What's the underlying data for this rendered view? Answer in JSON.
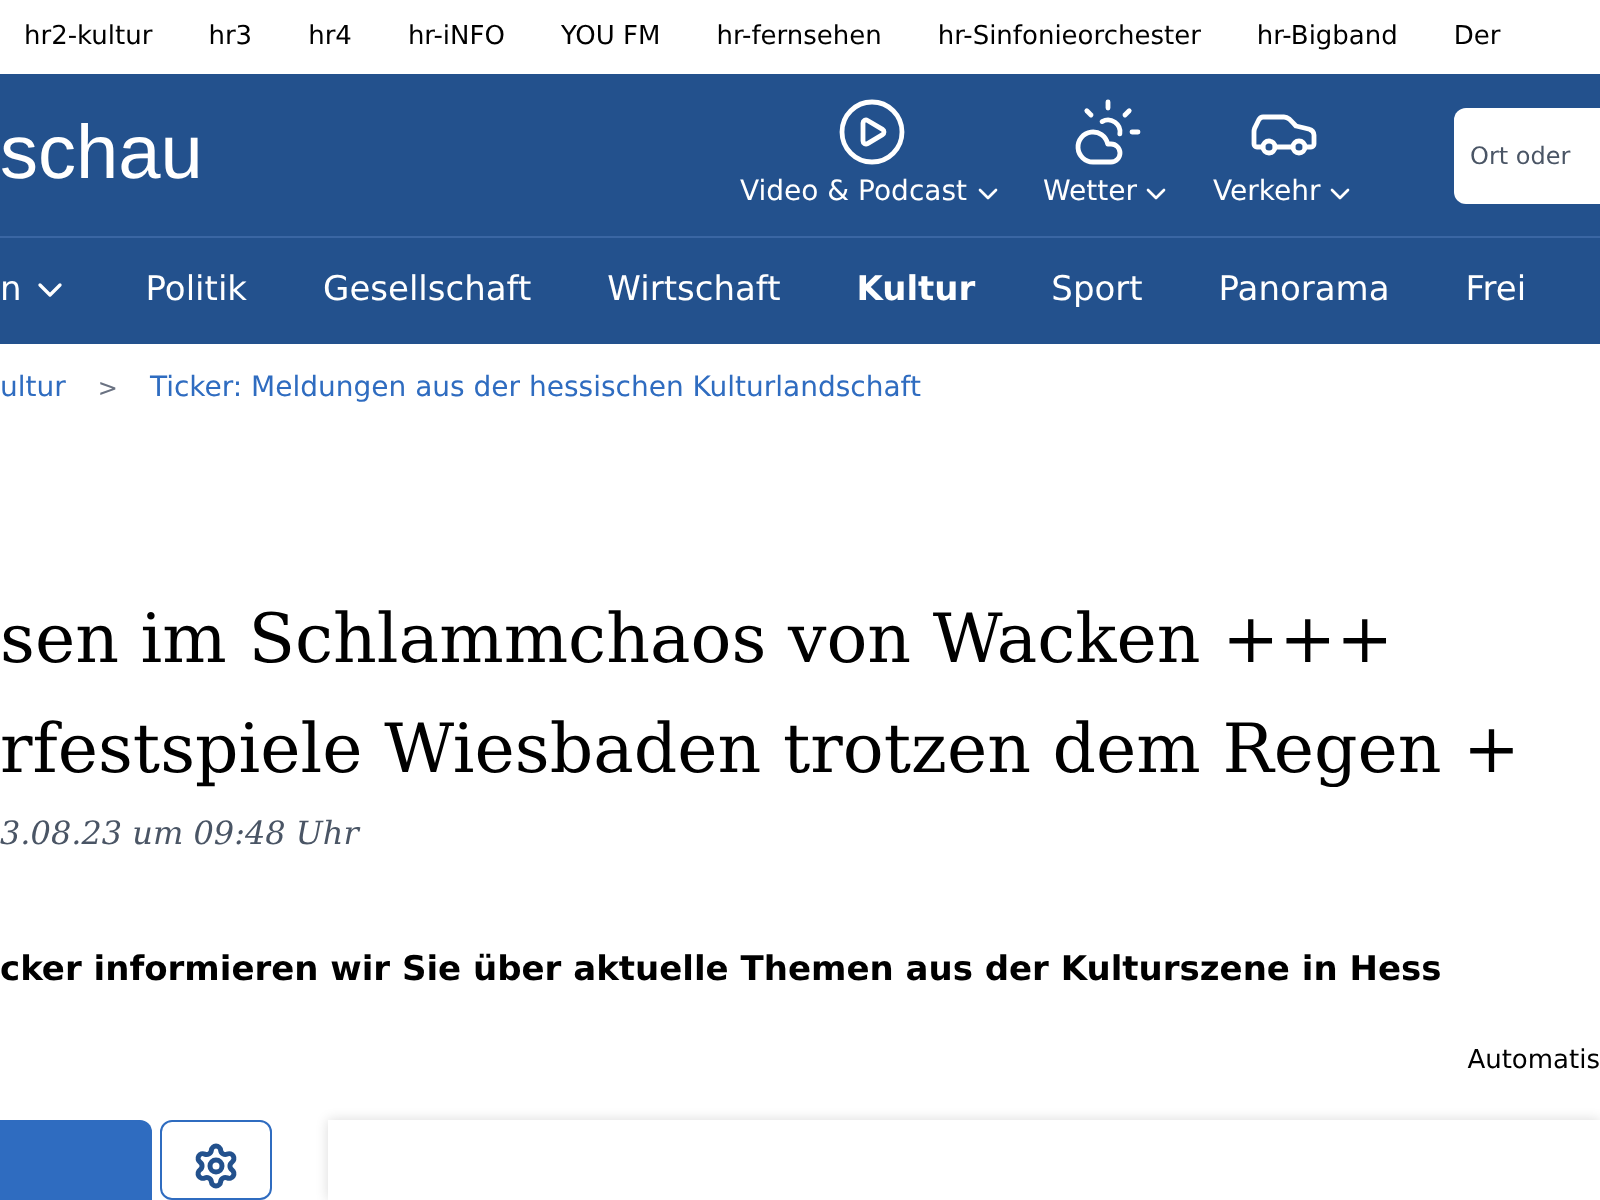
{
  "top_links": [
    "hr2-kultur",
    "hr3",
    "hr4",
    "hr-iNFO",
    "YOU FM",
    "hr-fernsehen",
    "hr-Sinfonieorchester",
    "hr-Bigband",
    "Der"
  ],
  "header": {
    "logo_text": "schau",
    "menus": [
      {
        "label": "Video & Podcast",
        "kind": "video"
      },
      {
        "label": "Wetter",
        "kind": "weather"
      },
      {
        "label": "Verkehr",
        "kind": "traffic"
      }
    ],
    "search": {
      "placeholder": "Ort oder"
    }
  },
  "nav": [
    {
      "label": "n",
      "selected": false,
      "dropdown": true
    },
    {
      "label": "Politik",
      "selected": false
    },
    {
      "label": "Gesellschaft",
      "selected": false
    },
    {
      "label": "Wirtschaft",
      "selected": false
    },
    {
      "label": "Kultur",
      "selected": true
    },
    {
      "label": "Sport",
      "selected": false
    },
    {
      "label": "Panorama",
      "selected": false
    },
    {
      "label": "Frei",
      "selected": false
    }
  ],
  "breadcrumb": [
    "ultur",
    "Ticker: Meldungen aus der hessischen Kulturlandschaft"
  ],
  "breadcrumb_separator": ">",
  "article": {
    "title_lines": [
      "sen im Schlammchaos von Wacken +++",
      "rfestspiele Wiesbaden trotzen dem Regen +"
    ],
    "date": "3.08.23 um 09:48 Uhr",
    "lede": "cker informieren wir Sie über aktuelle Themen aus der Kulturszene in Hess",
    "auto_label": "Automatis"
  }
}
